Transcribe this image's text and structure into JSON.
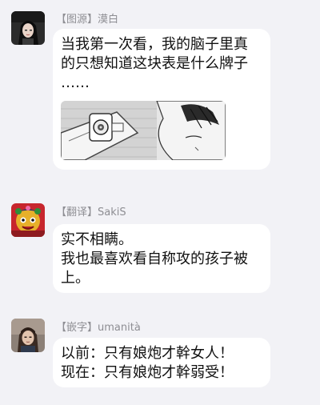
{
  "messages": [
    {
      "sender": "【图源】漠白",
      "lines": [
        "当我第一次看，我的脑子里真",
        "的只想知道这块表是什么牌子",
        "……"
      ],
      "attachment": "manga-watch-image"
    },
    {
      "sender": "【翻译】SakiS",
      "lines": [
        "实不相瞒。",
        "我也最喜欢看自称攻的孩子被",
        "上。"
      ]
    },
    {
      "sender": "【嵌字】umanità",
      "lines": [
        "以前：只有娘炮才幹女人！",
        "现在：只有娘炮才幹弱受！"
      ]
    }
  ],
  "colors": {
    "background": "#f2f2f6",
    "bubble": "#ffffff",
    "sender_text": "#8e8e93",
    "message_text": "#111111"
  }
}
